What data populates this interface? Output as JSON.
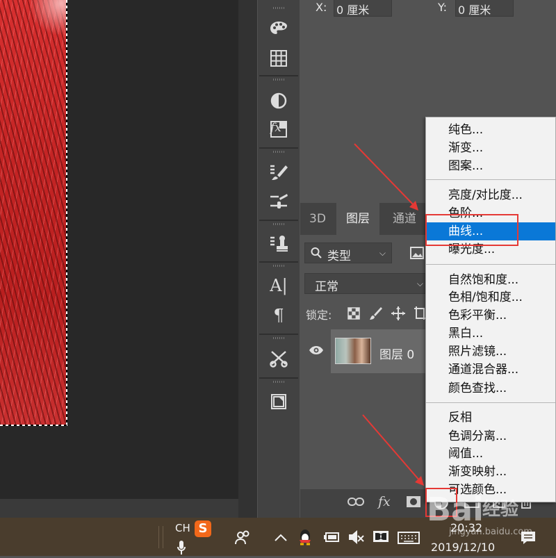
{
  "properties": {
    "x_label": "X:",
    "x_value": "0 厘米",
    "y_label": "Y:",
    "y_value": "0 厘米"
  },
  "layers_panel": {
    "tabs": [
      {
        "label": "3D",
        "active": false
      },
      {
        "label": "图层",
        "active": true
      },
      {
        "label": "通道",
        "active": false
      }
    ],
    "filter_value": "类型",
    "blend_mode": "正常",
    "lock_label": "锁定:",
    "layer": {
      "name": "图层 0",
      "visible": true
    },
    "bottom_icons": [
      "link-icon",
      "fx-icon",
      "mask-icon",
      "adjustment-icon",
      "group-icon",
      "new-layer-icon",
      "trash-icon"
    ],
    "fx_label": "fx"
  },
  "tools": {
    "type_glyph": "A|",
    "paragraph_glyph": "¶",
    "fx_glyph": "fx"
  },
  "context_menu": {
    "groups": [
      [
        "纯色...",
        "渐变...",
        "图案..."
      ],
      [
        "亮度/对比度...",
        "色阶...",
        "曲线...",
        "曝光度..."
      ],
      [
        "自然饱和度...",
        "色相/饱和度...",
        "色彩平衡...",
        "黑白...",
        "照片滤镜...",
        "通道混合器...",
        "颜色查找..."
      ],
      [
        "反相",
        "色调分离...",
        "阈值...",
        "渐变映射...",
        "可选颜色..."
      ]
    ],
    "selected": "曲线..."
  },
  "taskbar": {
    "ime_label": "CH",
    "ime_logo": "S",
    "time": "20:32",
    "date": "2019/12/10"
  },
  "watermark": {
    "brand_text": "经验",
    "brand_mark": "Bai",
    "url": "jingyan.baidu.com"
  },
  "colors": {
    "selection": "#0a78d7",
    "annotation": "#e53935",
    "panel_bg": "#535353",
    "taskbar_bg": "#4a3d2d"
  }
}
